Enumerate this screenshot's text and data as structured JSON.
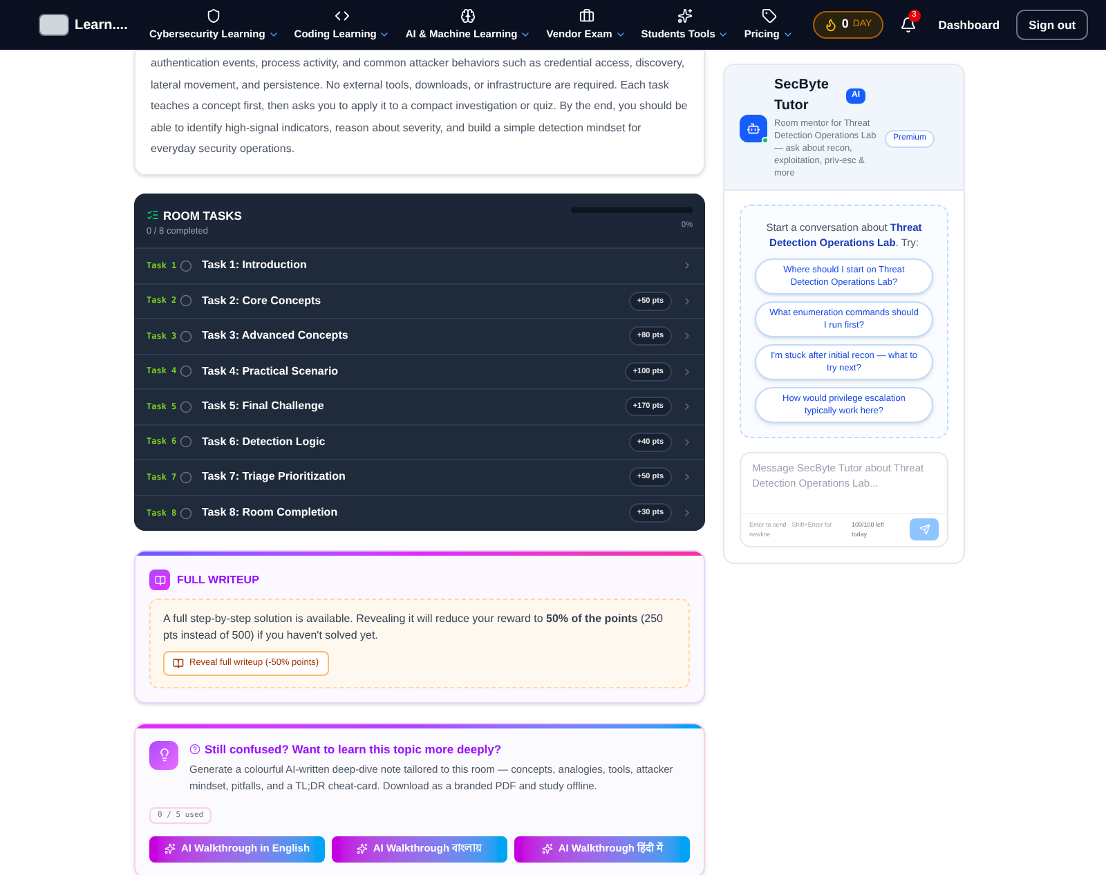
{
  "nav": {
    "brand": "Learn....",
    "items": [
      {
        "label": "Cybersecurity Learning"
      },
      {
        "label": "Coding Learning"
      },
      {
        "label": "AI & Machine Learning"
      },
      {
        "label": "Vendor Exam"
      },
      {
        "label": "Students Tools"
      },
      {
        "label": "Pricing"
      }
    ],
    "streak": {
      "count": "0",
      "unit": "DAY"
    },
    "notifications": "3",
    "dashboard": "Dashboard",
    "sign_out": "Sign out"
  },
  "intro": "authentication events, process activity, and common attacker behaviors such as credential access, discovery, lateral movement, and persistence. No external tools, downloads, or infrastructure are required. Each task teaches a concept first, then asks you to apply it to a compact investigation or quiz. By the end, you should be able to identify high-signal indicators, reason about severity, and build a simple detection mindset for everyday security operations.",
  "tasks": {
    "title": "ROOM TASKS",
    "completed": "0 / 8 completed",
    "level": 0,
    "percent": "0%",
    "items": [
      {
        "tag": "Task 1",
        "title": "Task 1: Introduction",
        "done": false
      },
      {
        "tag": "Task 2",
        "title": "Task 2: Core Concepts",
        "points": "+50 pts",
        "done": false
      },
      {
        "tag": "Task 3",
        "title": "Task 3: Advanced Concepts",
        "points": "+80 pts",
        "done": false
      },
      {
        "tag": "Task 4",
        "title": "Task 4: Practical Scenario",
        "points": "+100 pts",
        "done": false
      },
      {
        "tag": "Task 5",
        "title": "Task 5: Final Challenge",
        "points": "+170 pts",
        "done": false
      },
      {
        "tag": "Task 6",
        "title": "Task 6: Detection Logic",
        "points": "+40 pts",
        "done": false
      },
      {
        "tag": "Task 7",
        "title": "Task 7: Triage Prioritization",
        "points": "+50 pts",
        "done": false
      },
      {
        "tag": "Task 8",
        "title": "Task 8: Room Completion",
        "points": "+30 pts",
        "done": false
      }
    ]
  },
  "writeup": {
    "title": "FULL WRITEUP",
    "text": "A full step-by-step solution is available. Revealing it will reduce your reward to **50% of the points** (250 pts instead of 500) if you haven't solved yet.",
    "button": "Reveal full writeup (-50% points)"
  },
  "deep_dive": {
    "title": "Still confused? Want to learn this topic more deeply?",
    "text": "Generate a colourful AI-written deep-dive note tailored to this room — concepts, analogies, tools, attacker mindset, pitfalls, and a TL;DR cheat-card. Download as a branded PDF and study offline.",
    "usage": "0 / 5 used",
    "buttons": [
      "AI Walkthrough in English",
      "AI Walkthrough বাংলায়",
      "AI Walkthrough हिंदी में"
    ]
  },
  "tutor": {
    "name": "SecByte Tutor",
    "badge": "AI",
    "online": true,
    "description": "Room mentor for Threat Detection Operations Lab — ask about recon, exploitation, priv-esc & more",
    "plan": "Premium",
    "prompt": "Start a conversation about **Threat Detection Operations Lab**. Try:",
    "suggestions": [
      "Where should I start on Threat Detection Operations Lab?",
      "What enumeration commands should I run first?",
      "I'm stuck after initial recon — what to try next?",
      "How would privilege escalation typically work here?"
    ],
    "input": {
      "placeholder": "Message SecByte Tutor about Threat Detection Operations Lab..."
    },
    "hint": "Enter to send · Shift+Enter for newline",
    "quota": "100/100 left today"
  }
}
